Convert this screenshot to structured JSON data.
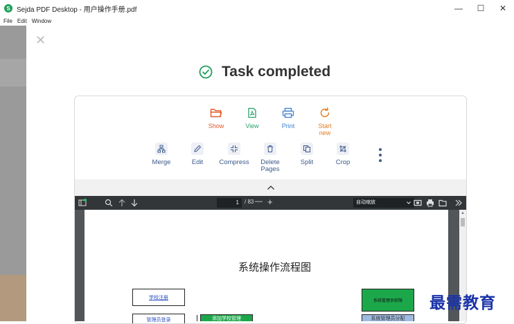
{
  "window": {
    "title": "Sejda PDF Desktop - 用户操作手册.pdf",
    "logo_letter": "S",
    "minimize": "—",
    "maximize": "☐",
    "close": "✕"
  },
  "menu": [
    "File",
    "Edit",
    "Window"
  ],
  "dialog": {
    "close": "✕",
    "title": "Task completed"
  },
  "actions": [
    {
      "label": "Show",
      "color": "#e05a2a",
      "icon": "folder-icon"
    },
    {
      "label": "View",
      "color": "#27a06b",
      "icon": "file-pdf-icon"
    },
    {
      "label": "Print",
      "color": "#3a7fd0",
      "icon": "printer-icon"
    },
    {
      "label": "Start new",
      "color": "#e07a1f",
      "icon": "restart-icon"
    }
  ],
  "tools": [
    {
      "label": "Merge",
      "icon": "merge-icon"
    },
    {
      "label": "Edit",
      "icon": "pencil-icon"
    },
    {
      "label": "Compress",
      "icon": "compress-icon"
    },
    {
      "label": "Delete Pages",
      "icon": "trash-icon"
    },
    {
      "label": "Split",
      "icon": "split-icon"
    },
    {
      "label": "Crop",
      "icon": "crop-icon"
    }
  ],
  "pdf_toolbar": {
    "page_current": "1",
    "page_total": "/ 83",
    "zoom": "自动缩放",
    "minus": "—",
    "plus": "+"
  },
  "document": {
    "title": "系统操作流程图",
    "box_school_register": "学校注册",
    "box_system_admin": "系统管理员权限",
    "box_partial_1": "管理员登录",
    "box_partial_2": "添加学校管理",
    "box_partial_3": "系统管理员分配"
  },
  "watermark": "最需教育",
  "colors": {
    "accent_green": "#1e9e5a",
    "tool_blue": "#3c5a8a",
    "pdf_bar": "#323639",
    "flow_green": "#1ca84a"
  }
}
